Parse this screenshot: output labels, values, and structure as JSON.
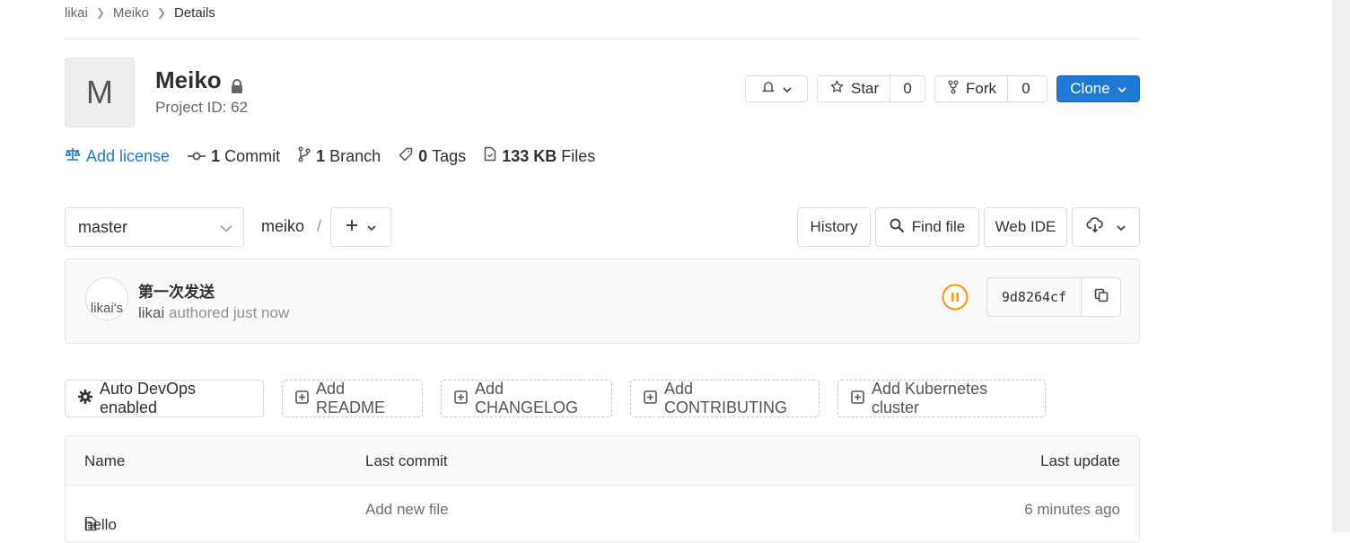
{
  "breadcrumb": {
    "items": [
      "likai",
      "Meiko",
      "Details"
    ]
  },
  "project": {
    "avatar_letter": "M",
    "name": "Meiko",
    "id_text": "Project ID: 62"
  },
  "actions": {
    "star_label": "Star",
    "star_count": "0",
    "fork_label": "Fork",
    "fork_count": "0",
    "clone_label": "Clone"
  },
  "stats": {
    "license_label": "Add license",
    "commits_count": "1",
    "commits_label": "Commit",
    "branches_count": "1",
    "branches_label": "Branch",
    "tags_count": "0",
    "tags_label": "Tags",
    "size_value": "133 KB",
    "size_label": "Files"
  },
  "tree": {
    "branch": "master",
    "path_root": "meiko",
    "path_sep": "/",
    "history_label": "History",
    "find_file_label": "Find file",
    "web_ide_label": "Web IDE"
  },
  "last_commit": {
    "avatar_alt": "likai's",
    "title": "第一次发送",
    "author": "likai",
    "authored_text": "authored just now",
    "sha": "9d8264cf",
    "pipeline_status": "paused"
  },
  "quick_actions": [
    "Auto DevOps enabled",
    "Add README",
    "Add CHANGELOG",
    "Add CONTRIBUTING",
    "Add Kubernetes cluster"
  ],
  "files_table": {
    "headers": [
      "Name",
      "Last commit",
      "Last update"
    ],
    "rows": [
      {
        "name": "hello",
        "last_commit": "Add new file",
        "last_update": "6 minutes ago"
      }
    ]
  },
  "colors": {
    "accent": "#1f78d1",
    "pipeline": "#fc9403",
    "text": "#303030",
    "border": "#dbdbdb"
  }
}
